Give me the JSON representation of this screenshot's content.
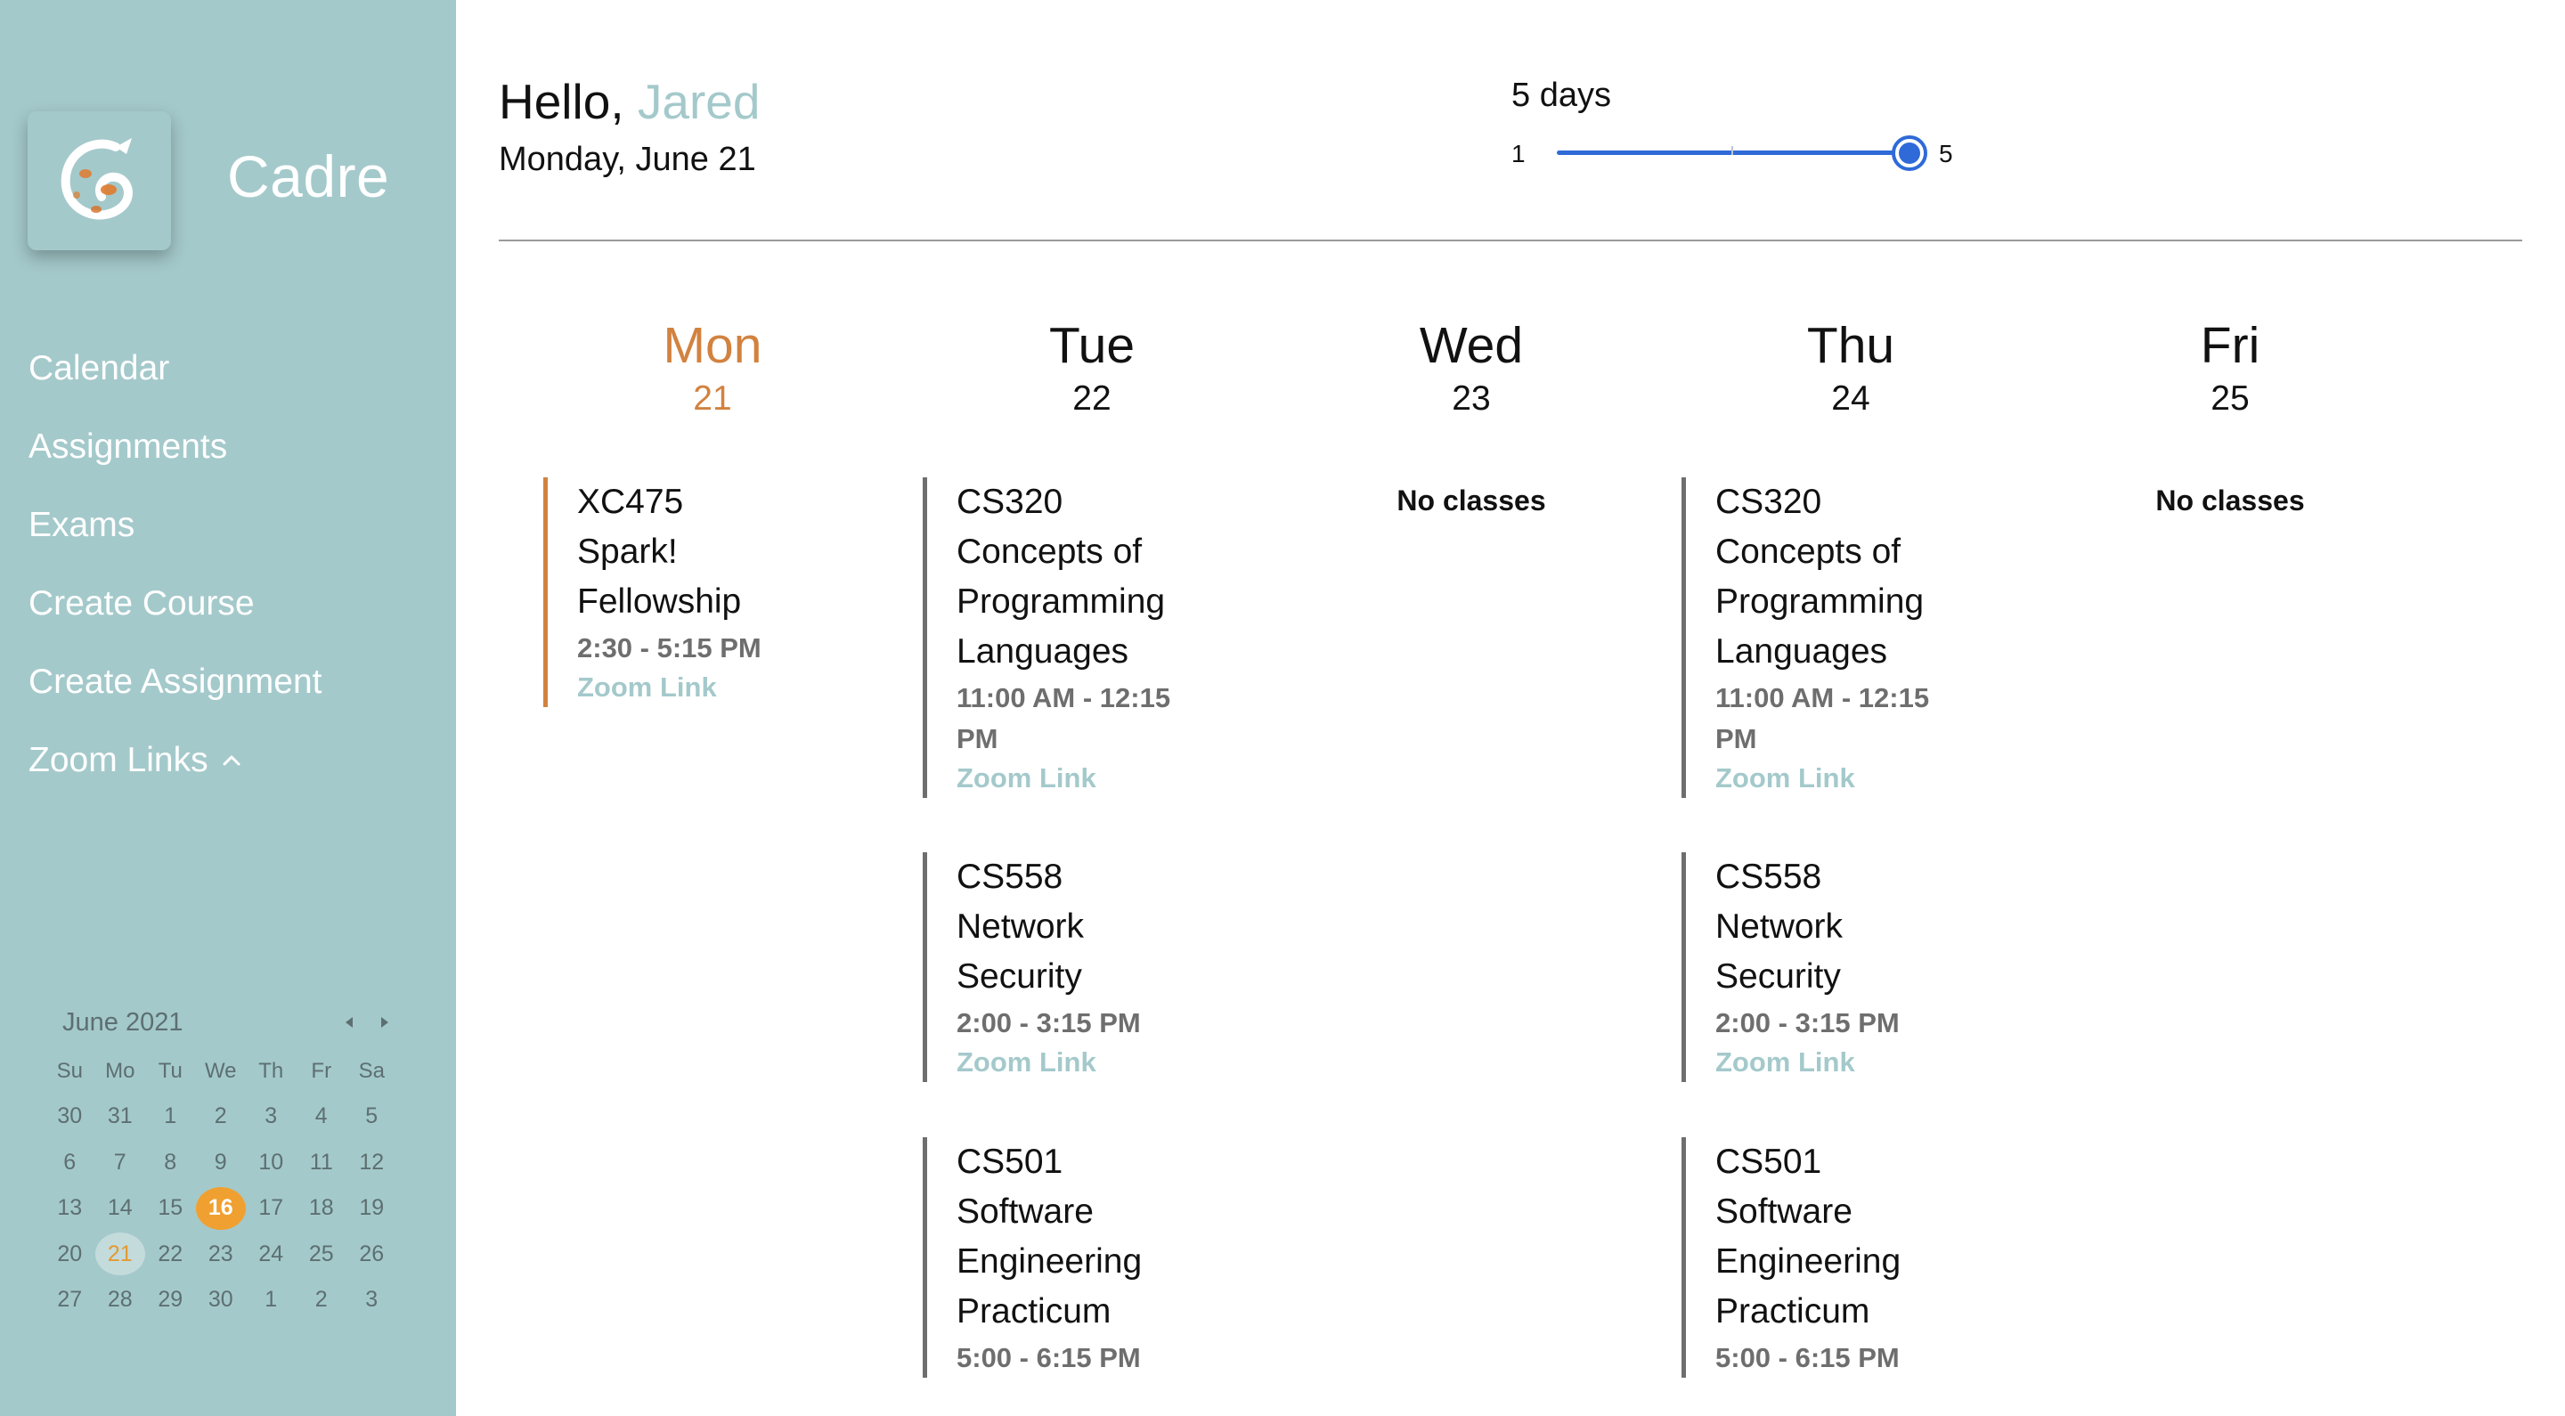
{
  "app": {
    "name": "Cadre"
  },
  "nav": {
    "items": [
      "Calendar",
      "Assignments",
      "Exams",
      "Create Course",
      "Create Assignment",
      "Zoom Links"
    ]
  },
  "header": {
    "greeting_prefix": "Hello, ",
    "user_name": "Jared",
    "date": "Monday, June 21"
  },
  "days_slider": {
    "label": "5 days",
    "min": "1",
    "max": "5",
    "value": 5
  },
  "mini_calendar": {
    "title": "June 2021",
    "weekdays": [
      "Su",
      "Mo",
      "Tu",
      "We",
      "Th",
      "Fr",
      "Sa"
    ],
    "weeks": [
      [
        "30",
        "31",
        "1",
        "2",
        "3",
        "4",
        "5"
      ],
      [
        "6",
        "7",
        "8",
        "9",
        "10",
        "11",
        "12"
      ],
      [
        "13",
        "14",
        "15",
        "16",
        "17",
        "18",
        "19"
      ],
      [
        "20",
        "21",
        "22",
        "23",
        "24",
        "25",
        "26"
      ],
      [
        "27",
        "28",
        "29",
        "30",
        "1",
        "2",
        "3"
      ]
    ],
    "today": "16",
    "selected": "21"
  },
  "week": {
    "days": [
      {
        "name": "Mon",
        "num": "21",
        "current": true,
        "no_classes": "",
        "events": [
          {
            "title": [
              "XC475",
              "Spark!",
              "Fellowship"
            ],
            "time": "2:30 - 5:15 PM",
            "link": "Zoom Link"
          }
        ]
      },
      {
        "name": "Tue",
        "num": "22",
        "current": false,
        "no_classes": "",
        "events": [
          {
            "title": [
              "CS320",
              "Concepts of",
              "Programming",
              "Languages"
            ],
            "time": [
              "11:00 AM - 12:15",
              "PM"
            ],
            "link": "Zoom Link"
          },
          {
            "title": [
              "CS558",
              "Network",
              "Security"
            ],
            "time": "2:00 - 3:15 PM",
            "link": "Zoom Link"
          },
          {
            "title": [
              "CS501",
              "Software",
              "Engineering",
              "Practicum"
            ],
            "time": "5:00 - 6:15 PM",
            "link": ""
          }
        ]
      },
      {
        "name": "Wed",
        "num": "23",
        "current": false,
        "no_classes": "No classes",
        "events": []
      },
      {
        "name": "Thu",
        "num": "24",
        "current": false,
        "no_classes": "",
        "events": [
          {
            "title": [
              "CS320",
              "Concepts of",
              "Programming",
              "Languages"
            ],
            "time": [
              "11:00 AM - 12:15",
              "PM"
            ],
            "link": "Zoom Link"
          },
          {
            "title": [
              "CS558",
              "Network",
              "Security"
            ],
            "time": "2:00 - 3:15 PM",
            "link": "Zoom Link"
          },
          {
            "title": [
              "CS501",
              "Software",
              "Engineering",
              "Practicum"
            ],
            "time": "5:00 - 6:15 PM",
            "link": ""
          }
        ]
      },
      {
        "name": "Fri",
        "num": "25",
        "current": false,
        "no_classes": "No classes",
        "events": []
      }
    ]
  },
  "colors": {
    "sidebar": "#a4c9cb",
    "accent_orange": "#d2823f",
    "slider_blue": "#2f6ad8",
    "today_badge": "#f0a030"
  }
}
